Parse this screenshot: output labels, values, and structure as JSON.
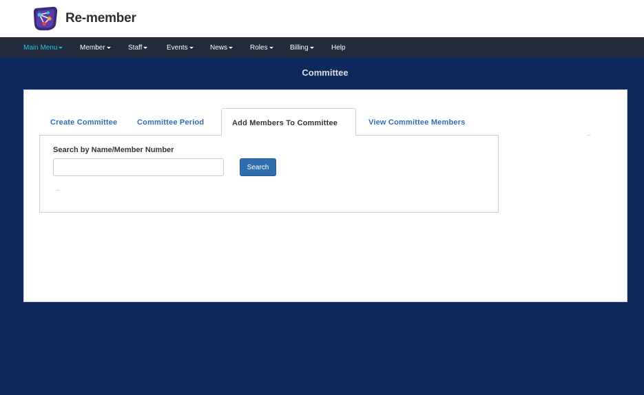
{
  "app": {
    "brand_name": "Re-member",
    "logo_icon": "remember-logo-icon"
  },
  "nav": {
    "items": [
      {
        "label": "Main Menu",
        "active": true,
        "has_caret": true
      },
      {
        "label": "Member",
        "active": false,
        "has_caret": true
      },
      {
        "label": "Staff",
        "active": false,
        "has_caret": true
      },
      {
        "label": "Events",
        "active": false,
        "has_caret": true
      },
      {
        "label": "News",
        "active": false,
        "has_caret": true
      },
      {
        "label": "Roles",
        "active": false,
        "has_caret": true
      },
      {
        "label": "Billing",
        "active": false,
        "has_caret": true
      },
      {
        "label": "Help",
        "active": false,
        "has_caret": false
      }
    ]
  },
  "page": {
    "title": "Committee"
  },
  "tabs": [
    {
      "label": "Create Committee",
      "active": false
    },
    {
      "label": "Committee Period",
      "active": false
    },
    {
      "label": "Add Members To Committee",
      "active": true
    },
    {
      "label": "View Committee Members",
      "active": false
    }
  ],
  "search": {
    "label": "Search by Name/Member Number",
    "value": "",
    "placeholder": "",
    "button_label": "Search"
  },
  "colors": {
    "page_background": "#0e2a5c",
    "navbar_background": "#232a3b",
    "active_nav": "#2bc0e4",
    "tab_link": "#2e6db4",
    "primary_button": "#2f6fb0"
  }
}
